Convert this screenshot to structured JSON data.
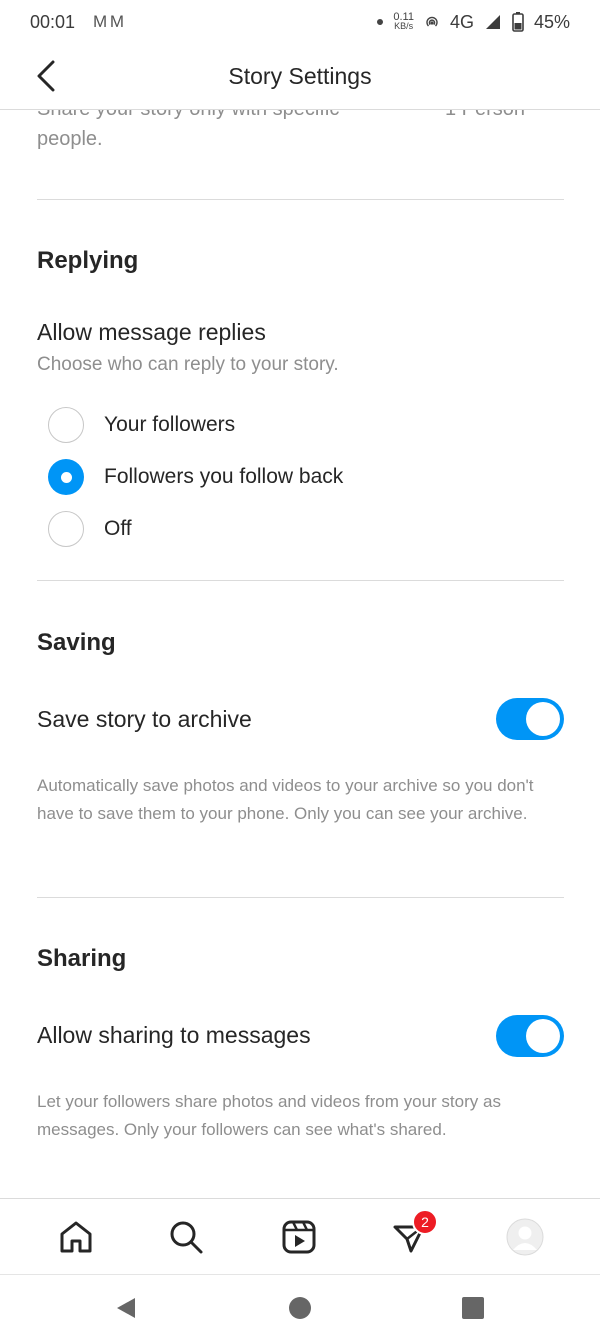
{
  "status_bar": {
    "time": "00:01",
    "mail_icons": "M M",
    "speed_value": "0.11",
    "speed_unit": "KB/s",
    "network": "4G",
    "battery": "45%"
  },
  "header": {
    "title": "Story Settings"
  },
  "previous_section": {
    "clipped_text": "Share your story only with specific",
    "clipped_right": "1 Person",
    "desc_tail": "people."
  },
  "replying": {
    "title": "Replying",
    "setting_title": "Allow message replies",
    "setting_sub": "Choose who can reply to your story.",
    "options": [
      {
        "label": "Your followers",
        "selected": false
      },
      {
        "label": "Followers you follow back",
        "selected": true
      },
      {
        "label": "Off",
        "selected": false
      }
    ]
  },
  "saving": {
    "title": "Saving",
    "setting_title": "Save story to archive",
    "toggle_on": true,
    "desc": "Automatically save photos and videos to your archive so you don't have to save them to your phone. Only you can see your archive."
  },
  "sharing": {
    "title": "Sharing",
    "setting_title": "Allow sharing to messages",
    "toggle_on": true,
    "desc": "Let your followers share photos and videos from your story as messages. Only your followers can see what's shared."
  },
  "bottom_nav": {
    "items": [
      "home-icon",
      "search-icon",
      "reels-icon",
      "activity-icon",
      "profile-avatar"
    ],
    "badge_count": "2"
  },
  "colors": {
    "accent": "#0095f6",
    "badge": "#ed1c24",
    "secondary_text": "#8e8e8e",
    "divider": "#dbdbdb"
  }
}
